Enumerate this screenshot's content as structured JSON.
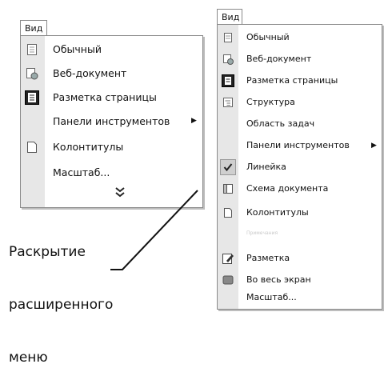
{
  "left_menu": {
    "title": "Вид",
    "items": [
      {
        "label": "Обычный",
        "icon": "normal-view-icon"
      },
      {
        "label": "Веб-документ",
        "icon": "web-document-icon"
      },
      {
        "label": "Разметка страницы",
        "icon": "page-layout-icon"
      },
      {
        "label": "Панели инструментов",
        "icon": "",
        "submenu": true
      },
      {
        "label": "Колонтитулы",
        "icon": "header-footer-icon"
      },
      {
        "label": "Масштаб...",
        "icon": ""
      }
    ],
    "expand_glyph": "⌄⌄"
  },
  "right_menu": {
    "title": "Вид",
    "items": [
      {
        "label": "Обычный",
        "icon": "normal-view-icon"
      },
      {
        "label": "Веб-документ",
        "icon": "web-document-icon"
      },
      {
        "label": "Разметка страницы",
        "icon": "page-layout-icon"
      },
      {
        "label": "Структура",
        "icon": "outline-icon"
      },
      {
        "label": "Область задач",
        "icon": ""
      },
      {
        "label": "Панели инструментов",
        "icon": "",
        "submenu": true
      },
      {
        "label": "Линейка",
        "icon": "check-icon"
      },
      {
        "label": "Схема документа",
        "icon": "document-map-icon"
      },
      {
        "label": "Колонтитулы",
        "icon": "header-footer-icon"
      },
      {
        "label": "Примечания",
        "icon": "",
        "disabled": true
      },
      {
        "label": "Разметка",
        "icon": "markup-icon"
      },
      {
        "label": "Во весь экран",
        "icon": "full-screen-icon"
      },
      {
        "label": "Масштаб...",
        "icon": ""
      }
    ]
  },
  "caption": {
    "line1": "Раскрытие",
    "line2": "расширенного",
    "line3": "меню"
  }
}
